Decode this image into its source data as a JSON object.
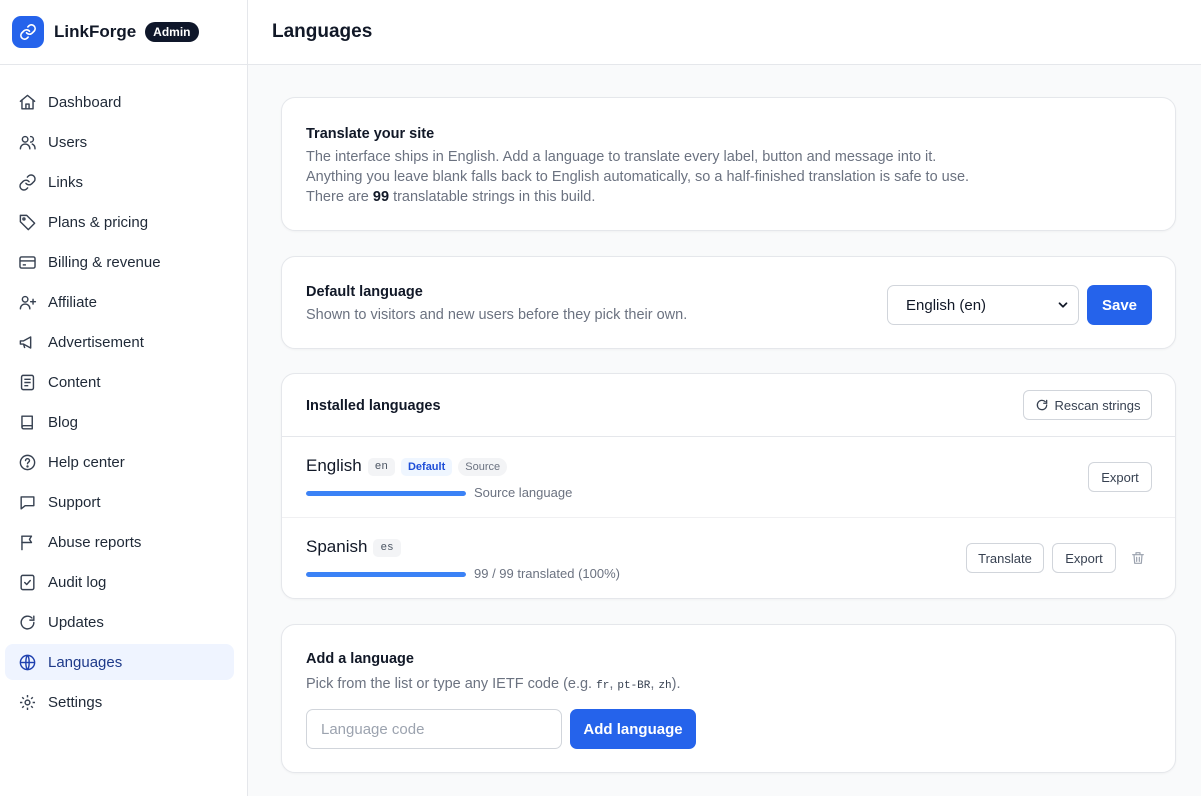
{
  "app": {
    "name": "LinkForge",
    "role_badge": "Admin"
  },
  "colors": {
    "accent": "#2563eb",
    "progress": "#3b82f6",
    "active_nav_bg": "#eff4ff",
    "badge_dark": "#0f172a"
  },
  "sidebar": {
    "items": [
      {
        "label": "Dashboard",
        "icon": "home-icon"
      },
      {
        "label": "Users",
        "icon": "users-icon"
      },
      {
        "label": "Links",
        "icon": "link-icon"
      },
      {
        "label": "Plans & pricing",
        "icon": "tag-icon"
      },
      {
        "label": "Billing & revenue",
        "icon": "credit-card-icon"
      },
      {
        "label": "Affiliate",
        "icon": "user-plus-icon"
      },
      {
        "label": "Advertisement",
        "icon": "megaphone-icon"
      },
      {
        "label": "Content",
        "icon": "document-icon"
      },
      {
        "label": "Blog",
        "icon": "book-icon"
      },
      {
        "label": "Help center",
        "icon": "help-circle-icon"
      },
      {
        "label": "Support",
        "icon": "chat-icon"
      },
      {
        "label": "Abuse reports",
        "icon": "flag-icon"
      },
      {
        "label": "Audit log",
        "icon": "checklist-icon"
      },
      {
        "label": "Updates",
        "icon": "refresh-icon"
      },
      {
        "label": "Languages",
        "icon": "globe-icon",
        "active": true
      },
      {
        "label": "Settings",
        "icon": "gear-icon"
      }
    ]
  },
  "header": {
    "title": "Languages"
  },
  "intro": {
    "title": "Translate your site",
    "line1": "The interface ships in English. Add a language to translate every label, button and message into it.",
    "line2": "Anything you leave blank falls back to English automatically, so a half-finished translation is safe to use.",
    "line3_prefix": "There are ",
    "line3_count": "99",
    "line3_suffix": " translatable strings in this build."
  },
  "default_language": {
    "title": "Default language",
    "description": "Shown to visitors and new users before they pick their own.",
    "selected": "English (en)",
    "save_label": "Save"
  },
  "installed": {
    "title": "Installed languages",
    "rescan_label": "Rescan strings",
    "languages": [
      {
        "name": "English",
        "code": "en",
        "badges": [
          "Default",
          "Source"
        ],
        "progress": 1.0,
        "status": "Source language",
        "actions": [
          "Export"
        ]
      },
      {
        "name": "Spanish",
        "code": "es",
        "badges": [],
        "progress": 1.0,
        "status": "99 / 99 translated (100%)",
        "actions": [
          "Translate",
          "Export"
        ],
        "deletable": true
      }
    ]
  },
  "add_language": {
    "title": "Add a language",
    "hint_prefix": "Pick from the list or type any IETF code (e.g. ",
    "hint_code1": "fr",
    "hint_sep1": ", ",
    "hint_code2": "pt-BR",
    "hint_sep2": ", ",
    "hint_code3": "zh",
    "hint_suffix": ").",
    "input_placeholder": "Language code",
    "button_label": "Add language"
  }
}
